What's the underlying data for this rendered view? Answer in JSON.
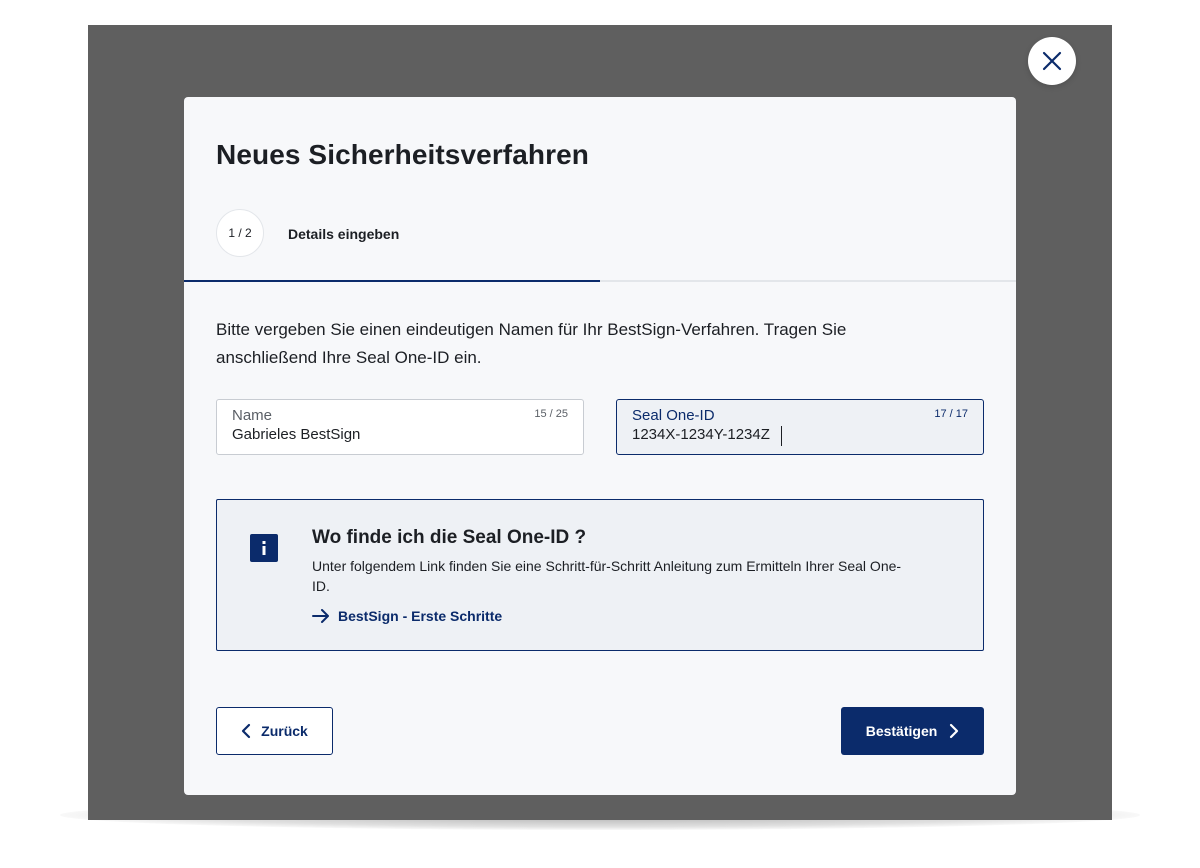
{
  "modal": {
    "title": "Neues Sicherheitsverfahren",
    "step": {
      "indicator": "1 / 2",
      "label": "Details eingeben",
      "progress_fraction": 0.5
    },
    "intro_text": "Bitte vergeben Sie einen eindeutigen Namen für Ihr BestSign-Verfahren. Tragen Sie anschließend Ihre Seal One-ID ein.",
    "name_field": {
      "label": "Name",
      "counter": "15 / 25",
      "value": "Gabrieles BestSign"
    },
    "seal_field": {
      "label": "Seal One-ID",
      "counter": "17 / 17",
      "value": "1234X-1234Y-1234Z"
    },
    "info": {
      "title": "Wo finde ich die Seal One-ID ?",
      "text": "Unter folgendem Link finden Sie eine Schritt-für-Schritt Anleitung zum Ermitteln Ihrer Seal One-ID.",
      "link_label": "BestSign - Erste Schritte"
    },
    "buttons": {
      "back_label": "Zurück",
      "confirm_label": "Bestätigen"
    }
  },
  "icons": {
    "close": "close-icon",
    "info": "info-icon",
    "arrow_right": "arrow-right-icon",
    "chevron_left": "chevron-left-icon",
    "chevron_right": "chevron-right-icon"
  },
  "colors": {
    "brand": "#0b2b6b",
    "backdrop": "#5f5f5f",
    "modal_bg": "#f7f8fa"
  }
}
